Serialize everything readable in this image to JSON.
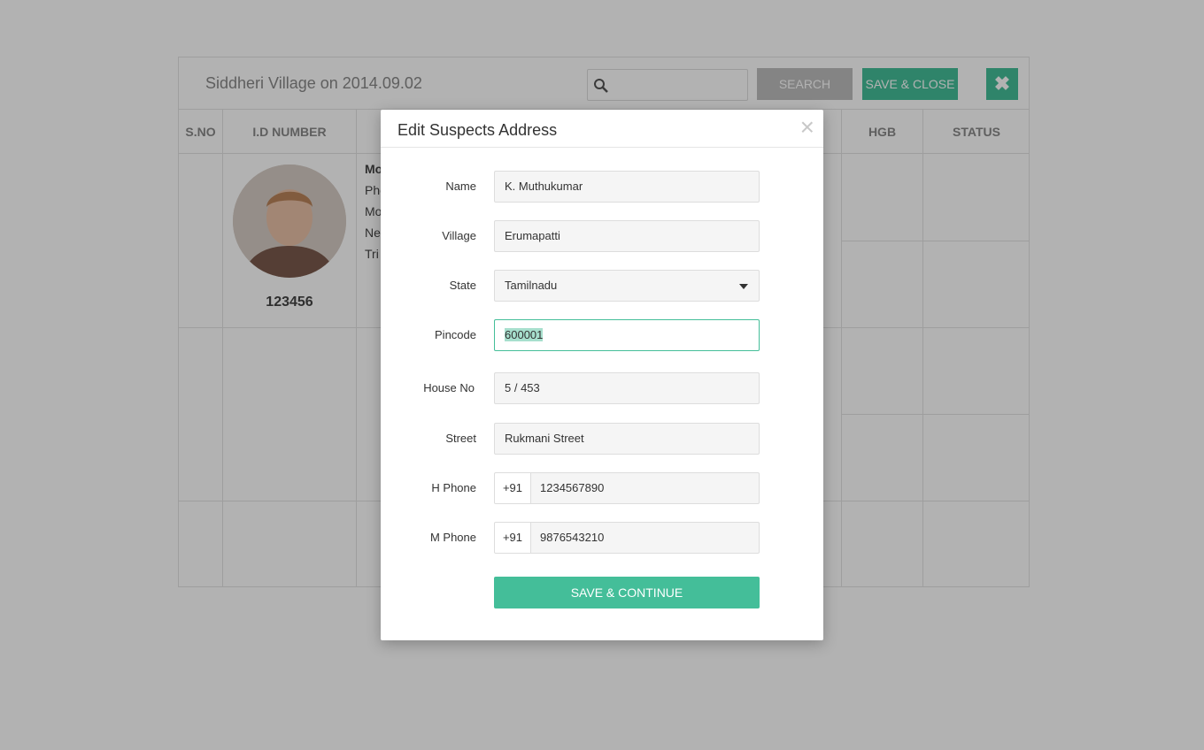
{
  "background": {
    "title": "Siddheri Village on 2014.09.02",
    "search": {
      "button_label": "SEARCH",
      "value": ""
    },
    "save_close_label": "SAVE & CLOSE",
    "close_icon": "x-icon",
    "columns": [
      "S.NO",
      "I.D NUMBER",
      "HGB",
      "STATUS"
    ],
    "row": {
      "id_number": "123456",
      "info_partial": [
        "Mo",
        "Pho",
        "Mo",
        "Ne",
        "Tri"
      ]
    }
  },
  "modal": {
    "title": "Edit Suspects Address",
    "close_symbol": "×",
    "fields": {
      "name": {
        "label": "Name",
        "value": "K. Muthukumar"
      },
      "village": {
        "label": "Village",
        "value": "Erumapatti"
      },
      "state": {
        "label": "State",
        "value": "Tamilnadu"
      },
      "pincode": {
        "label": "Pincode",
        "value": "600001"
      },
      "house_no": {
        "label": "House No",
        "value": "5 / 453"
      },
      "street": {
        "label": "Street",
        "value": "Rukmani Street"
      },
      "h_phone": {
        "label": "H Phone",
        "prefix": "+91",
        "value": "1234567890"
      },
      "m_phone": {
        "label": "M Phone",
        "prefix": "+91",
        "value": "9876543210"
      }
    },
    "submit_label": "SAVE & CONTINUE"
  },
  "colors": {
    "accent": "#44be99",
    "overlay": "rgba(0,0,0,0.30)"
  }
}
